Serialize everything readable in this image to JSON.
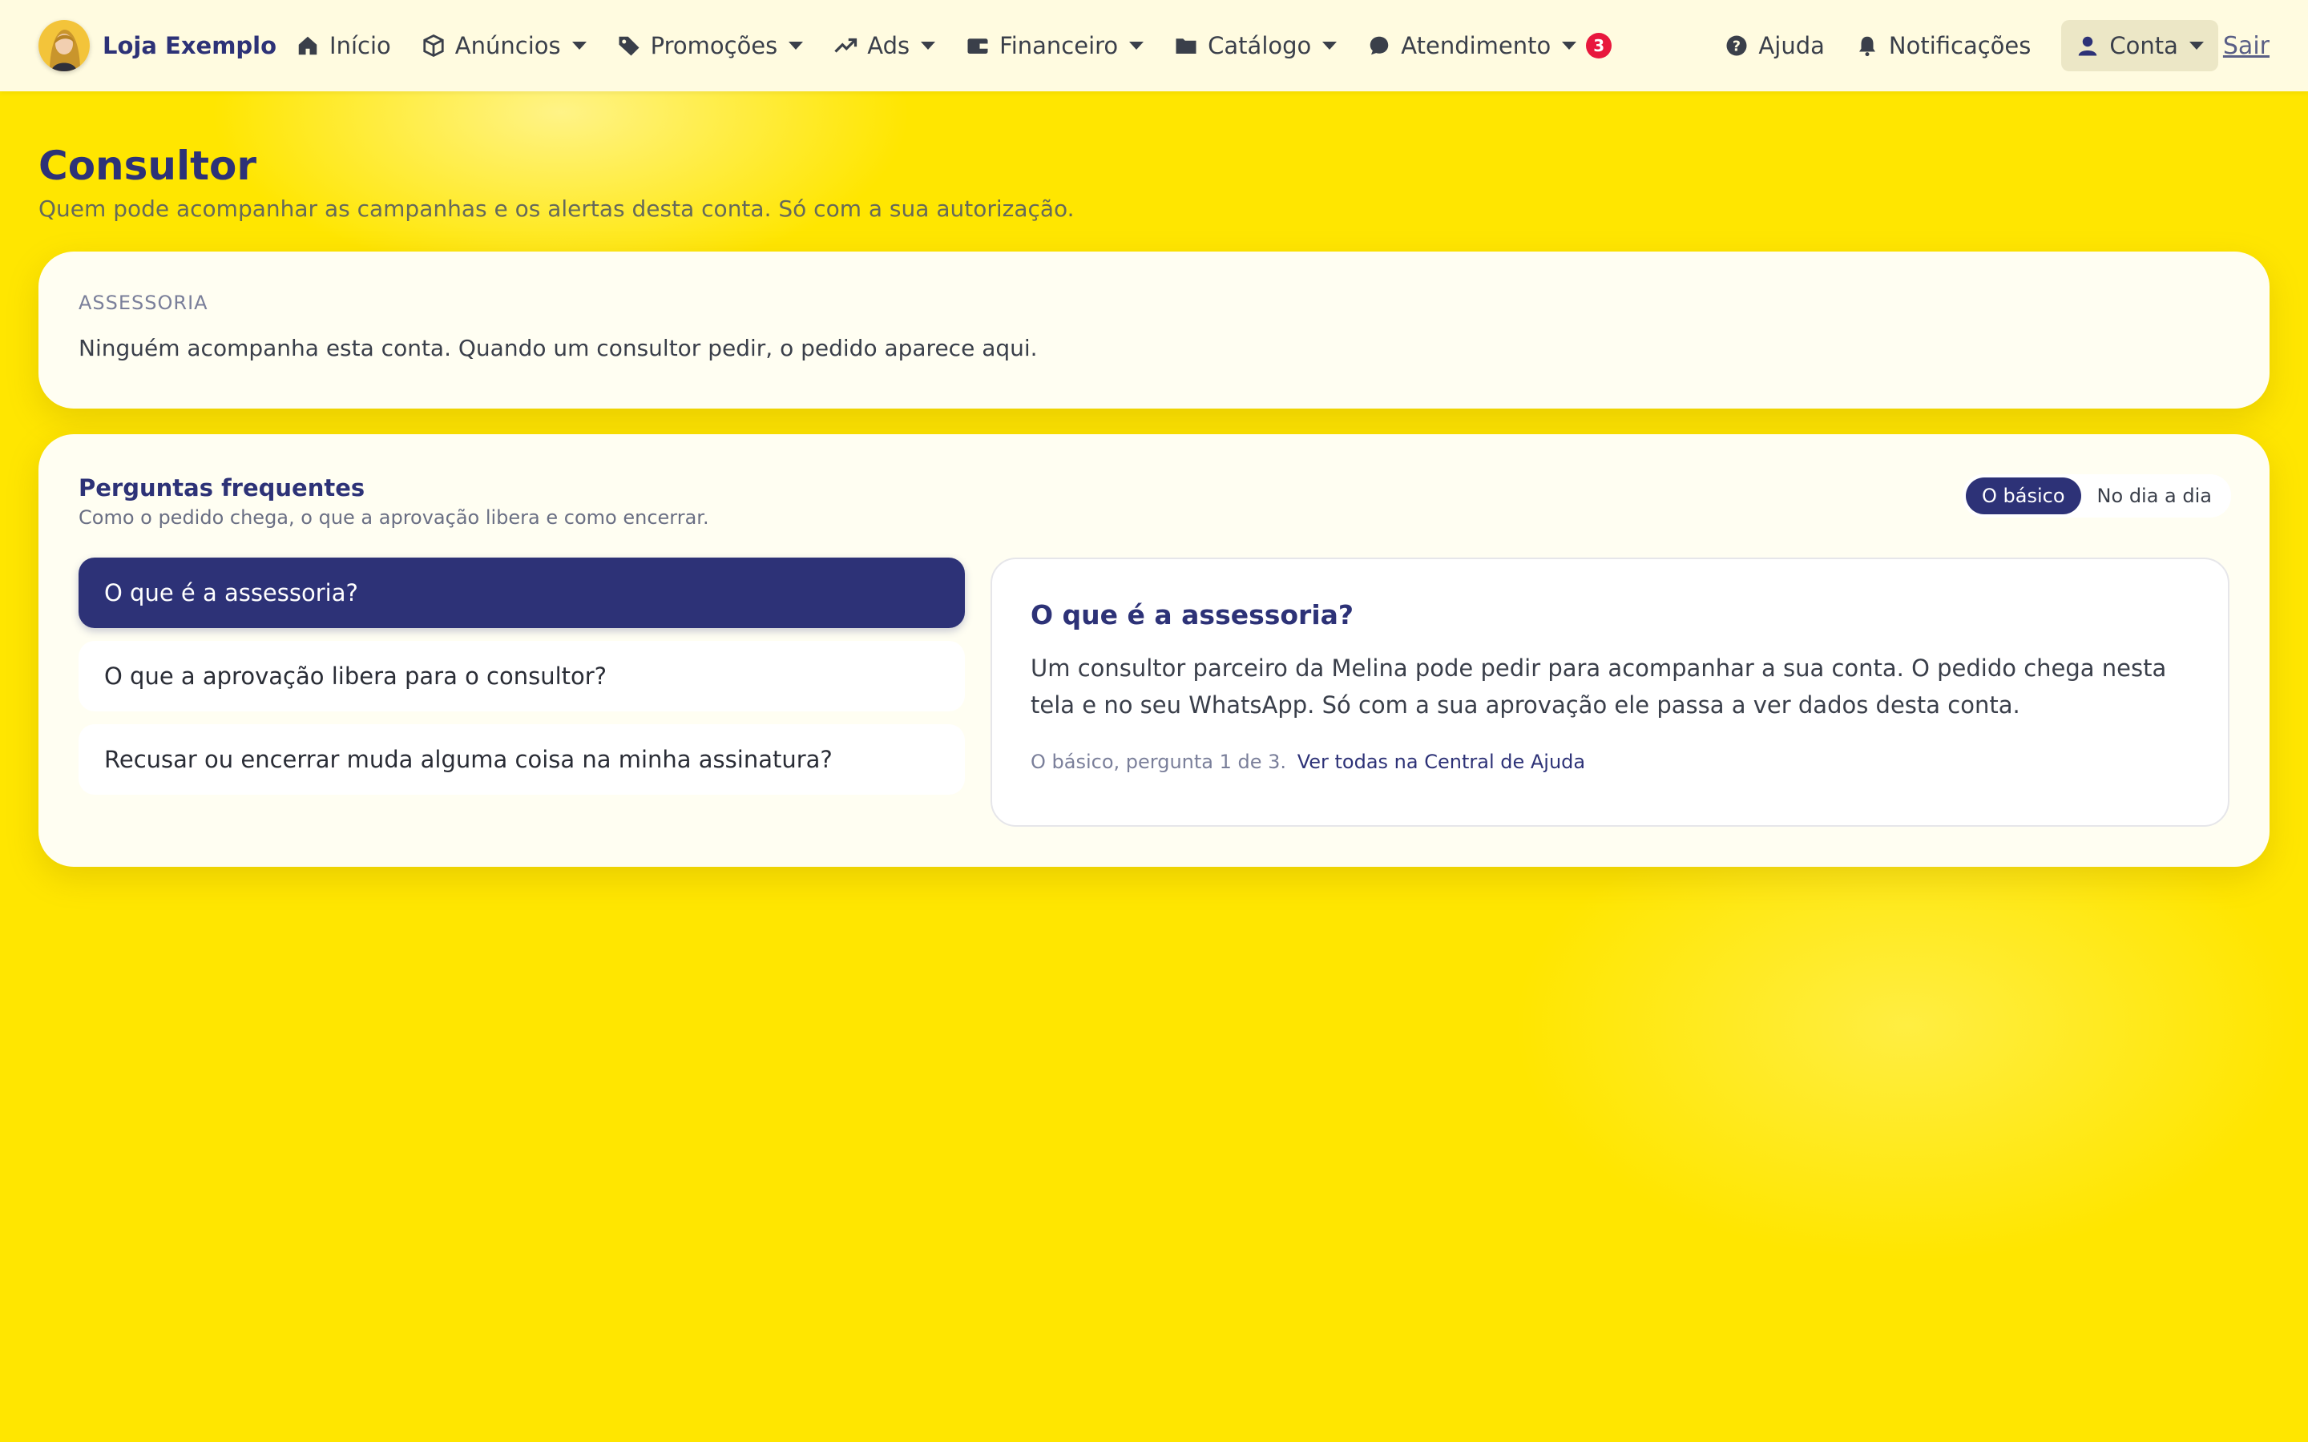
{
  "header": {
    "store_name": "Loja Exemplo",
    "nav": [
      {
        "label": "Início",
        "icon": "home-icon"
      },
      {
        "label": "Anúncios",
        "icon": "box-icon"
      },
      {
        "label": "Promoções",
        "icon": "tag-icon"
      },
      {
        "label": "Ads",
        "icon": "trend-up-icon"
      },
      {
        "label": "Financeiro",
        "icon": "wallet-icon"
      },
      {
        "label": "Catálogo",
        "icon": "folder-icon"
      },
      {
        "label": "Atendimento",
        "icon": "chat-icon",
        "badge": "3"
      }
    ],
    "help_label": "Ajuda",
    "notifications_label": "Notificações",
    "account_label": "Conta",
    "logout_label": "Sair"
  },
  "page": {
    "title": "Consultor",
    "subtitle": "Quem pode acompanhar as campanhas e os alertas desta conta. Só com a sua autorização."
  },
  "advisory": {
    "eyebrow": "ASSESSORIA",
    "message": "Ninguém acompanha esta conta. Quando um consultor pedir, o pedido aparece aqui."
  },
  "faq": {
    "title": "Perguntas frequentes",
    "subtitle": "Como o pedido chega, o que a aprovação libera e como encerrar.",
    "tabs": [
      {
        "label": "O básico",
        "active": true
      },
      {
        "label": "No dia a dia",
        "active": false
      }
    ],
    "questions": [
      {
        "label": "O que é a assessoria?",
        "active": true
      },
      {
        "label": "O que a aprovação libera para o consultor?",
        "active": false
      },
      {
        "label": "Recusar ou encerrar muda alguma coisa na minha assinatura?",
        "active": false
      }
    ],
    "answer": {
      "title": "O que é a assessoria?",
      "body": "Um consultor parceiro da Melina pode pedir para acompanhar a sua conta. O pedido chega nesta tela e no seu WhatsApp. Só com a sua aprovação ele passa a ver dados desta conta.",
      "footer_text": "O básico, pergunta 1 de 3.",
      "footer_link": "Ver todas na Central de Ajuda"
    }
  },
  "colors": {
    "background": "#ffe600",
    "primary": "#2d3277",
    "badge": "#e8173d"
  }
}
